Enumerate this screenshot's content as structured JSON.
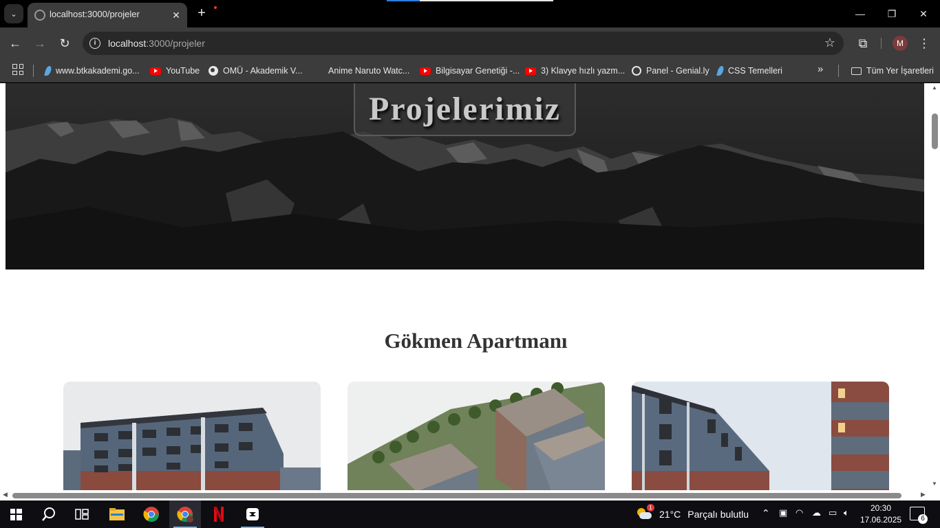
{
  "browser": {
    "tab_title": "localhost:3000/projeler",
    "url_host": "localhost",
    "url_path": ":3000/projeler",
    "avatar_initial": "M",
    "icons": {
      "tab_menu": "chevron-down-icon",
      "close": "close-icon",
      "new_tab": "plus-icon",
      "back": "arrow-left-icon",
      "forward": "arrow-right-icon",
      "reload": "reload-icon",
      "site_info": "info-icon",
      "bookmark_star": "star-icon",
      "extensions": "puzzle-icon",
      "menu": "kebab-menu-icon"
    }
  },
  "bookmarks": [
    {
      "label": "www.btkakademi.go...",
      "icon": "btk-icon"
    },
    {
      "label": "YouTube",
      "icon": "youtube-icon"
    },
    {
      "label": "OMÜ - Akademik V...",
      "icon": "globe-icon"
    },
    {
      "label": "Anime Naruto Watc...",
      "icon": "blank-icon"
    },
    {
      "label": "Bilgisayar Genetiği -...",
      "icon": "youtube-icon"
    },
    {
      "label": "3) Klavye hızlı yazm...",
      "icon": "youtube-icon"
    },
    {
      "label": "Panel - Genial.ly",
      "icon": "genially-icon"
    },
    {
      "label": "CSS Temelleri",
      "icon": "btk-icon"
    }
  ],
  "bookmarks_more": "»",
  "all_bookmarks_label": "Tüm Yer İşaretleri",
  "page": {
    "hero_title": "Projelerimiz",
    "section_title": "Gökmen Apartmanı",
    "project_images": [
      "apartment-front-image",
      "apartment-aerial-image",
      "apartment-side-image"
    ]
  },
  "taskbar": {
    "weather_temp": "21°C",
    "weather_desc": "Parçalı bulutlu",
    "weather_badge": "1",
    "time": "20:30",
    "date": "17.06.2025",
    "notification_count": "6",
    "apps": [
      "start-icon",
      "search-icon",
      "task-view-icon",
      "file-explorer-icon",
      "chrome-icon",
      "chrome-profile-icon",
      "netflix-icon",
      "capcut-icon"
    ]
  },
  "colors": {
    "browser_chrome": "#3c3c3c",
    "tab_strip": "#000000",
    "page_bg": "#ffffff",
    "hero_text": "#c9c9c9",
    "section_title": "#333333",
    "taskbar": "#0d0d12"
  }
}
